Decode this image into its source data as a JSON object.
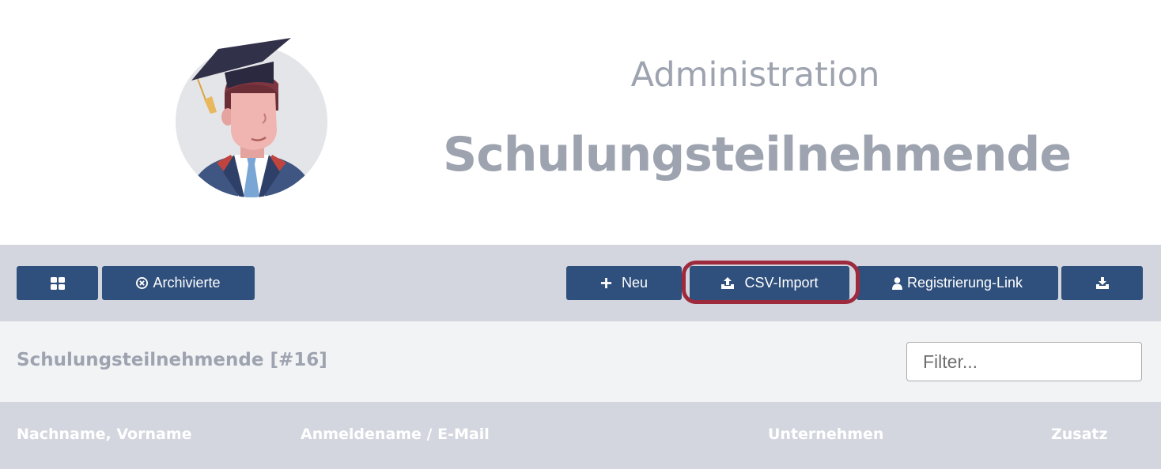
{
  "header": {
    "subtitle": "Administration",
    "title": "Schulungsteilnehmende"
  },
  "toolbar": {
    "archived_label": "Archivierte",
    "new_label": "Neu",
    "csv_import_label": "CSV-Import",
    "registration_link_label": "Registrierung-Link",
    "button_color": "#2f4f7c",
    "highlight_color": "#9e2b3d"
  },
  "list": {
    "title": "Schulungsteilnehmende [#16]",
    "filter_placeholder": "Filter..."
  },
  "table": {
    "columns": [
      "Nachname, Vorname",
      "Anmeldename / E-Mail",
      "Unternehmen",
      "Zusatz"
    ]
  }
}
